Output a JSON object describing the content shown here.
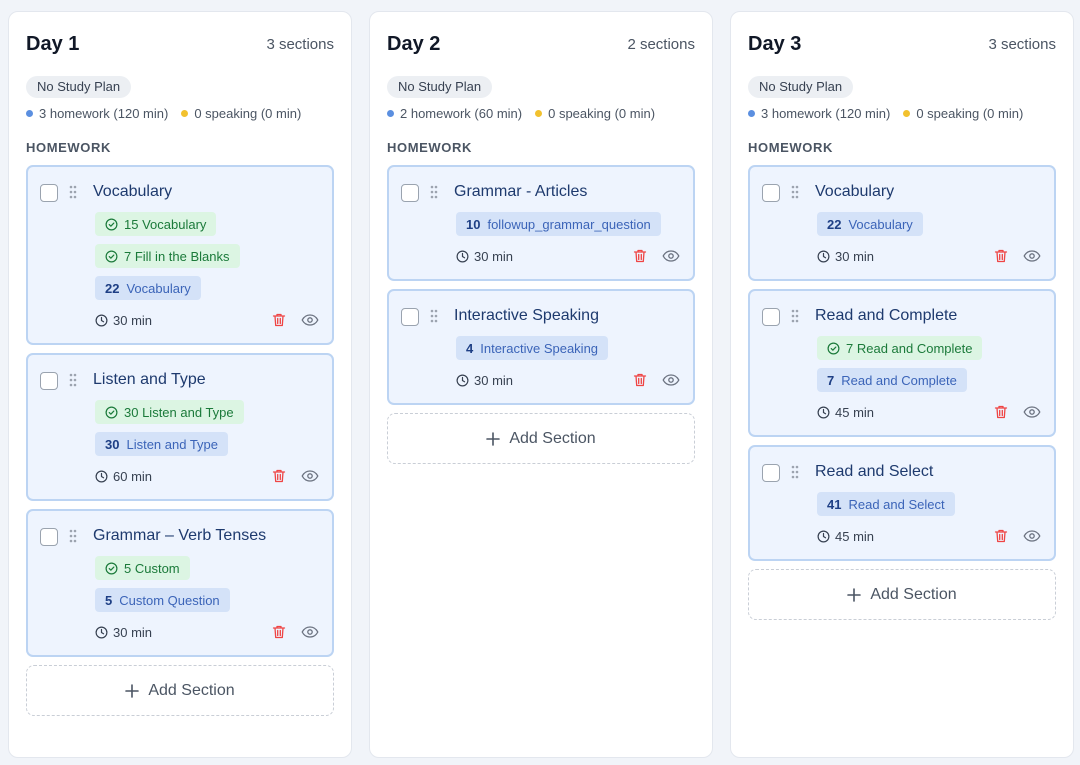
{
  "days": [
    {
      "title": "Day 1",
      "sections_count": "3 sections",
      "plan_badge": "No Study Plan",
      "homework_stat": "3 homework (120 min)",
      "speaking_stat": "0 speaking (0 min)",
      "homework_label": "HOMEWORK",
      "add_section_label": "Add Section",
      "cards": [
        {
          "title": "Vocabulary",
          "green_chips": [
            "15 Vocabulary",
            "7 Fill in the Blanks"
          ],
          "blue_chip": {
            "num": "22",
            "label": "Vocabulary"
          },
          "duration": "30 min"
        },
        {
          "title": "Listen and Type",
          "green_chips": [
            "30 Listen and Type"
          ],
          "blue_chip": {
            "num": "30",
            "label": "Listen and Type"
          },
          "duration": "60 min"
        },
        {
          "title": "Grammar – Verb Tenses",
          "green_chips": [
            "5 Custom"
          ],
          "blue_chip": {
            "num": "5",
            "label": "Custom Question"
          },
          "duration": "30 min"
        }
      ]
    },
    {
      "title": "Day 2",
      "sections_count": "2 sections",
      "plan_badge": "No Study Plan",
      "homework_stat": "2 homework (60 min)",
      "speaking_stat": "0 speaking (0 min)",
      "homework_label": "HOMEWORK",
      "add_section_label": "Add Section",
      "cards": [
        {
          "title": "Grammar - Articles",
          "green_chips": [],
          "blue_chip": {
            "num": "10",
            "label": "followup_grammar_question"
          },
          "duration": "30 min"
        },
        {
          "title": "Interactive Speaking",
          "green_chips": [],
          "blue_chip": {
            "num": "4",
            "label": "Interactive Speaking"
          },
          "duration": "30 min"
        }
      ]
    },
    {
      "title": "Day 3",
      "sections_count": "3 sections",
      "plan_badge": "No Study Plan",
      "homework_stat": "3 homework (120 min)",
      "speaking_stat": "0 speaking (0 min)",
      "homework_label": "HOMEWORK",
      "add_section_label": "Add Section",
      "cards": [
        {
          "title": "Vocabulary",
          "green_chips": [],
          "blue_chip": {
            "num": "22",
            "label": "Vocabulary"
          },
          "duration": "30 min"
        },
        {
          "title": "Read and Complete",
          "green_chips": [
            "7 Read and Complete"
          ],
          "blue_chip": {
            "num": "7",
            "label": "Read and Complete"
          },
          "duration": "45 min"
        },
        {
          "title": "Read and Select",
          "green_chips": [],
          "blue_chip": {
            "num": "41",
            "label": "Read and Select"
          },
          "duration": "45 min"
        }
      ]
    }
  ],
  "icons": {
    "drag": "grip-icon",
    "check": "check-circle-icon",
    "clock": "clock-icon",
    "trash": "trash-icon",
    "eye": "eye-icon",
    "plus": "plus-icon"
  },
  "colors": {
    "homework_dot": "#5b8fe0",
    "speaking_dot": "#f2c12e",
    "card_bg": "#eef4fe",
    "card_border": "#bcd4f3",
    "trash": "#ef4444"
  }
}
